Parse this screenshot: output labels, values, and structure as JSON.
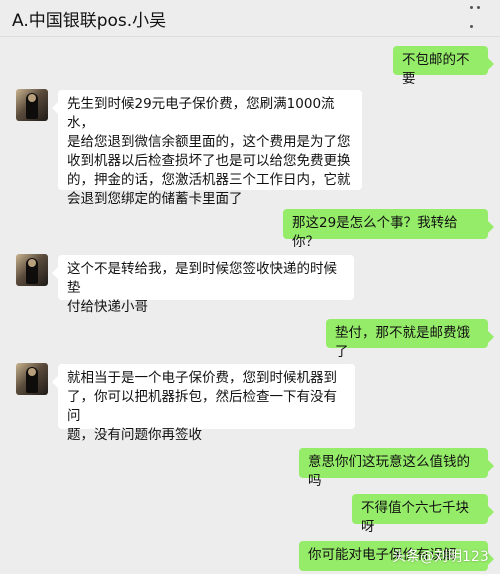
{
  "header": {
    "title": "A.中国银联pos.小吴"
  },
  "messages": [
    {
      "side": "out",
      "text": "不包邮的不要"
    },
    {
      "side": "in",
      "text": "先生到时候29元电子保价费，您刷满1000流水，\n是给您退到微信余额里面的，这个费用是为了您\n收到机器以后检查损坏了也是可以给您免费更换\n的，押金的话，您激活机器三个工作日内，它就\n会退到您绑定的储蓄卡里面了"
    },
    {
      "side": "out",
      "text": "那这29是怎么个事？我转给你？"
    },
    {
      "side": "in",
      "text": "这个不是转给我，是到时候您签收快递的时候垫\n付给快递小哥"
    },
    {
      "side": "out",
      "text": "垫付，那不就是邮费饿了"
    },
    {
      "side": "in",
      "text": "就相当于是一个电子保价费，您到时候机器到\n了，你可以把机器拆包，然后检查一下有没有问\n题，没有问题你再签收"
    },
    {
      "side": "out",
      "text": "意思你们这玩意这么值钱的吗"
    },
    {
      "side": "out",
      "text": "不得值个六七千块呀"
    },
    {
      "side": "out",
      "text": "你可能对电子保价有误解"
    }
  ],
  "watermark": "头条@刘明123"
}
